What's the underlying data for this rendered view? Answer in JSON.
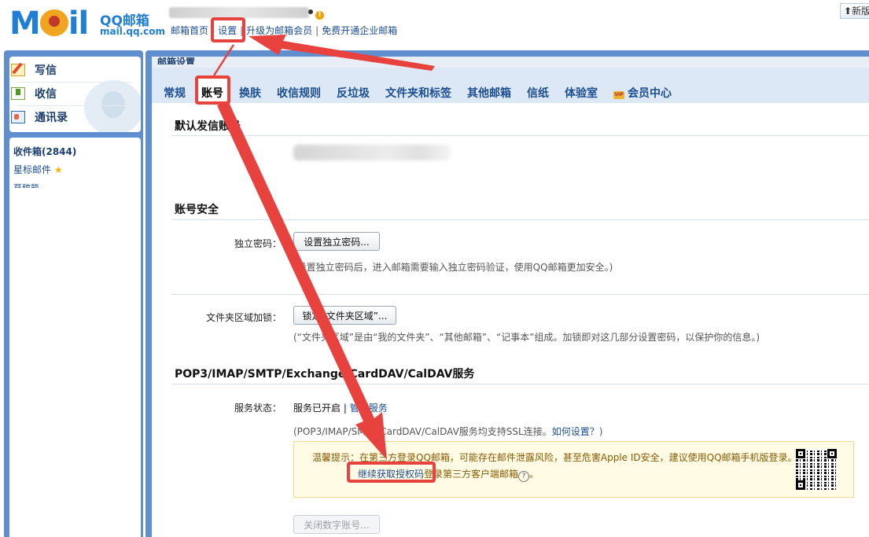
{
  "header": {
    "logo_word": "Mail",
    "brand": "QQ邮箱",
    "domain": "mail.qq.com",
    "nav": [
      {
        "label": "邮箱首页"
      },
      {
        "label": "设置"
      },
      {
        "label": "升级为邮箱会员"
      },
      {
        "label": "免费开通企业邮箱"
      }
    ],
    "new_button": "新版",
    "warn_glyph": "!",
    "new_glyph": "⬆"
  },
  "sidebar": {
    "actions": [
      {
        "label": "写信",
        "icon": "write-icon"
      },
      {
        "label": "收信",
        "icon": "receive-icon"
      },
      {
        "label": "通讯录",
        "icon": "contacts-icon"
      }
    ],
    "folders": {
      "inbox": "收件箱(2844)",
      "starred": "星标邮件",
      "starred_glyph": "★",
      "drafts": "草稿箱"
    }
  },
  "main": {
    "title": "邮箱设置",
    "tabs": [
      {
        "label": "常规"
      },
      {
        "label": "账号",
        "active": true
      },
      {
        "label": "换肤"
      },
      {
        "label": "收信规则"
      },
      {
        "label": "反垃圾"
      },
      {
        "label": "文件夹和标签"
      },
      {
        "label": "其他邮箱"
      },
      {
        "label": "信纸"
      },
      {
        "label": "体验室"
      },
      {
        "label": "会员中心",
        "icon": "vip-icon"
      }
    ],
    "vip_badge": "VIP",
    "default_account": {
      "heading": "默认发信账号"
    },
    "security": {
      "heading": "账号安全",
      "password_label": "独立密码：",
      "password_button": "设置独立密码...",
      "password_hint": "(设置独立密码后，进入邮箱需要输入独立密码验证，使用QQ邮箱更加安全。)",
      "folder_lock_label": "文件夹区域加锁：",
      "folder_lock_button": "锁定“文件夹区域”...",
      "folder_lock_hint": "(“文件夹区域”是由“我的文件夹”、“其他邮箱”、“记事本”组成。加锁即对这几部分设置密码，以保护你的信息。)"
    },
    "pop3": {
      "heading": "POP3/IMAP/SMTP/Exchange/CardDAV/CalDAV服务",
      "status_label": "服务状态：",
      "status_text": "服务已开启",
      "manage_link": "管理服务",
      "ssl_hint": "(POP3/IMAP/SMTP/CardDAV/CalDAV服务均支持SSL连接。",
      "how_link": "如何设置？",
      "ssl_hint_close": ")",
      "tip_line1": "温馨提示：在第三方登录QQ邮箱，可能存在邮件泄露风险，甚至危害Apple ID安全，建议使用QQ邮箱手机版登录。",
      "tip_link": "继续获取授权码",
      "tip_line2_rest": "登录第三方客户端邮箱",
      "help_glyph": "?",
      "tip_line2_end": "。",
      "close_button": "关闭数字账号..."
    }
  },
  "colors": {
    "accent": "#1f7fd6",
    "frame": "#5f8fcf",
    "link": "#1b4d92",
    "annotation": "#e8423f",
    "tip_bg": "#fffbe5"
  }
}
